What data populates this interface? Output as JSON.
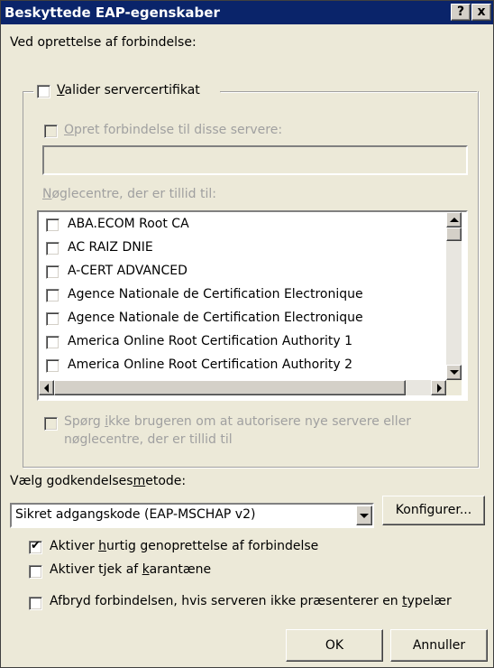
{
  "window": {
    "title": "Beskyttede EAP-egenskaber",
    "help": "?",
    "close": "x"
  },
  "connect_label": "Ved oprettelse af forbindelse:",
  "validate": {
    "label_u": "V",
    "label": "alider servercertifikat",
    "checked": false
  },
  "connect_servers": {
    "label_u": "O",
    "label": "pret forbindelse til disse servere:",
    "value": ""
  },
  "trusted_label_u": "N",
  "trusted_label": "øglecentre, der er tillid til:",
  "ca_list": [
    "ABA.ECOM Root CA",
    "AC RAIZ DNIE",
    "A-CERT ADVANCED",
    "Agence Nationale de Certification Electronique",
    "Agence Nationale de Certification Electronique",
    "America Online Root Certification Authority 1",
    "America Online Root Certification Authority 2"
  ],
  "prompt": {
    "line1_a": "Spørg ",
    "line1_u": "i",
    "line1_b": "kke brugeren om at autorisere nye servere eller",
    "line2": "nøglecentre, der er tillid til"
  },
  "auth_label_a": "Vælg godkendelses",
  "auth_label_u": "m",
  "auth_label_b": "etode:",
  "auth_method": "Sikret adgangskode (EAP-MSCHAP v2)",
  "configure_button": "Konfigurer...",
  "fast_reconnect": {
    "a": "Aktiver ",
    "u": "h",
    "b": "urtig genoprettelse af forbindelse",
    "checked": true
  },
  "quarantine": {
    "a": "Aktiver tjek af ",
    "u": "k",
    "b": "arantæne",
    "checked": false
  },
  "disconnect": {
    "a": "Afbryd forbindelsen, hvis serveren ikke præsenterer en ",
    "u": "t",
    "b": "ypelær",
    "checked": false
  },
  "ok_button": "OK",
  "cancel_button": "Annuller"
}
